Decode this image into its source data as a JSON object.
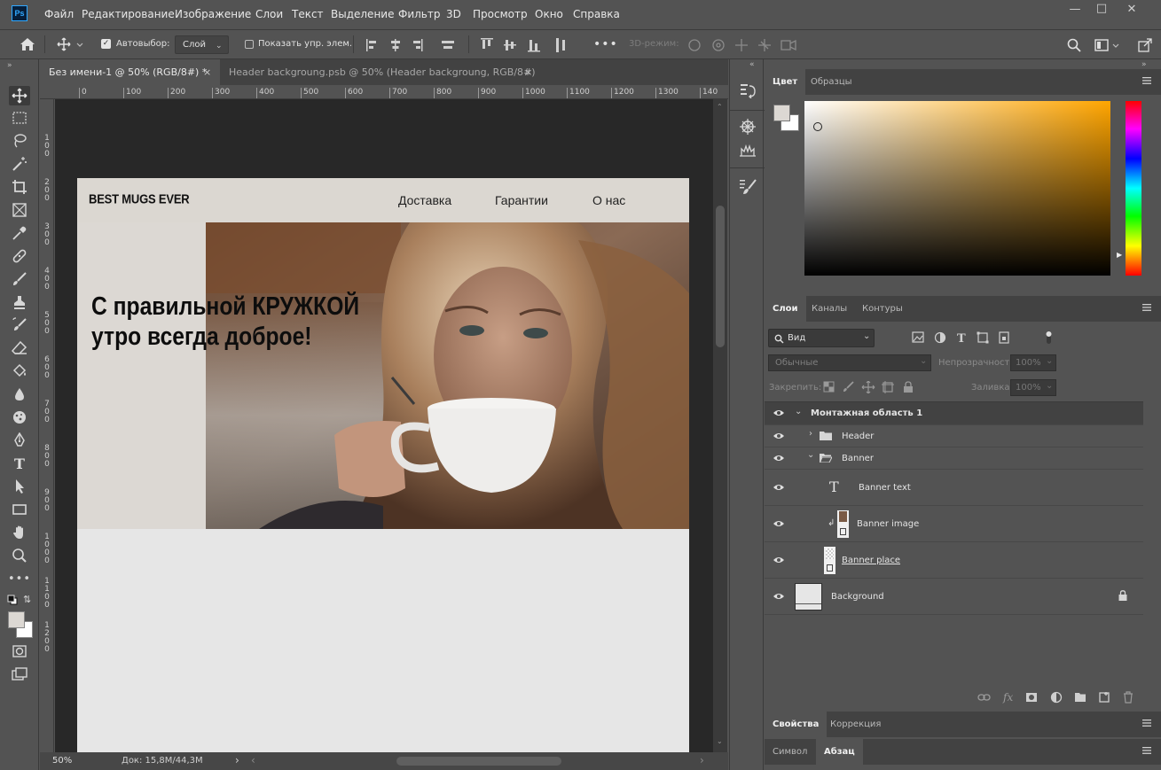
{
  "app": {
    "logo": "Ps"
  },
  "menu": [
    "Файл",
    "Редактирование",
    "Изображение",
    "Слои",
    "Текст",
    "Выделение",
    "Фильтр",
    "3D",
    "Просмотр",
    "Окно",
    "Справка"
  ],
  "options_bar": {
    "autoselect_label": "Автовыбор:",
    "autoselect_value": "Слой",
    "show_transform_label": "Показать упр. элем.",
    "mode3d_label": "3D-режим:"
  },
  "documents": {
    "tabs": [
      {
        "label": "Без имени-1 @ 50% (RGB/8#) *",
        "active": true
      },
      {
        "label": "Header backgroung.psb @ 50% (Header backgroung, RGB/8#)",
        "active": false
      }
    ],
    "ruler_h": [
      "0",
      "100",
      "200",
      "300",
      "400",
      "500",
      "600",
      "700",
      "800",
      "900",
      "1000",
      "1100",
      "1200",
      "1300",
      "140"
    ],
    "ruler_v": [
      "1\n0\n0",
      "2\n0\n0",
      "3\n0\n0",
      "4\n0\n0",
      "5\n0\n0",
      "6\n0\n0",
      "7\n0\n0",
      "8\n0\n0",
      "9\n0\n0",
      "1\n0\n0\n0",
      "1\n1\n0\n0",
      "1\n2\n0\n0"
    ],
    "status": {
      "zoom": "50%",
      "doc_size": "Док: 15,8M/44,3M"
    }
  },
  "artboard": {
    "logo": "BEST MUGS EVER",
    "nav": [
      "Доставка",
      "Гарантии",
      "О нас"
    ],
    "headline_line1": "С правильной КРУЖКОЙ",
    "headline_line2": "утро всегда доброе!"
  },
  "color_panel": {
    "tabs": [
      "Цвет",
      "Образцы"
    ],
    "foreground": "#dcd8d3",
    "background": "#ffffff",
    "hue_color": "#ffa500"
  },
  "layers_panel": {
    "tabs": [
      "Слои",
      "Каналы",
      "Контуры"
    ],
    "filter_label": "Вид",
    "blend_mode": "Обычные",
    "opacity_label": "Непрозрачность:",
    "opacity_value": "100%",
    "lock_label": "Закрепить:",
    "fill_label": "Заливка:",
    "fill_value": "100%",
    "layers": [
      {
        "name": "Монтажная область 1",
        "kind": "artboard"
      },
      {
        "name": "Header",
        "kind": "group-collapsed"
      },
      {
        "name": "Banner",
        "kind": "group-expanded"
      },
      {
        "name": "Banner text",
        "kind": "text"
      },
      {
        "name": "Banner image",
        "kind": "smart"
      },
      {
        "name": "Banner place",
        "kind": "shape"
      },
      {
        "name": "Background",
        "kind": "background"
      }
    ]
  },
  "bottom_panels": {
    "tabs1": [
      "Свойства",
      "Коррекция"
    ],
    "tabs2": [
      "Символ",
      "Абзац"
    ]
  }
}
